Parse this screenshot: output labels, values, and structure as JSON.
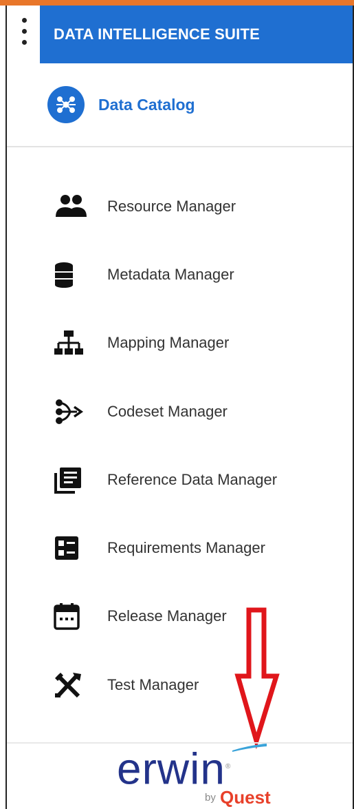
{
  "header": {
    "suite_title": "DATA INTELLIGENCE SUITE"
  },
  "catalog": {
    "label": "Data Catalog",
    "icon": "data-catalog-icon"
  },
  "menu": [
    {
      "label": "Resource Manager",
      "icon": "people-icon"
    },
    {
      "label": "Metadata Manager",
      "icon": "database-icon"
    },
    {
      "label": "Mapping Manager",
      "icon": "hierarchy-icon"
    },
    {
      "label": "Codeset Manager",
      "icon": "branch-arrow-icon"
    },
    {
      "label": "Reference Data Manager",
      "icon": "library-books-icon"
    },
    {
      "label": "Requirements Manager",
      "icon": "checklist-icon"
    },
    {
      "label": "Release Manager",
      "icon": "calendar-icon"
    },
    {
      "label": "Test Manager",
      "icon": "tools-icon"
    }
  ],
  "logo": {
    "brand": "erwin",
    "by": "by",
    "company": "Quest",
    "mark": "®"
  },
  "colors": {
    "accent": "#1f6fd1",
    "top_bar": "#e8762a",
    "arrow": "#e0161b",
    "erwin": "#23338a",
    "quest": "#e8402a"
  }
}
